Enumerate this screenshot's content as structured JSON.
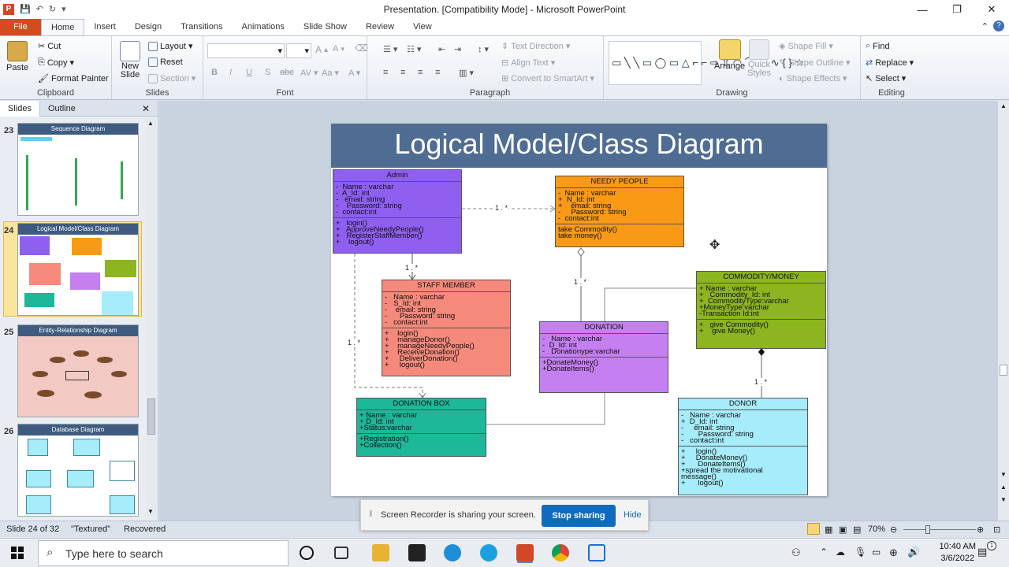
{
  "window": {
    "title": "Presentation. [Compatibility Mode] - Microsoft PowerPoint"
  },
  "tabs": [
    "File",
    "Home",
    "Insert",
    "Design",
    "Transitions",
    "Animations",
    "Slide Show",
    "Review",
    "View"
  ],
  "ribbon": {
    "clipboard": {
      "name": "Clipboard",
      "paste": "Paste",
      "cut": "Cut",
      "copy": "Copy",
      "format_painter": "Format Painter"
    },
    "slides": {
      "name": "Slides",
      "new_slide": "New Slide",
      "layout": "Layout",
      "reset": "Reset",
      "section": "Section"
    },
    "font": {
      "name": "Font"
    },
    "paragraph": {
      "name": "Paragraph",
      "text_direction": "Text Direction",
      "align_text": "Align Text",
      "convert": "Convert to SmartArt"
    },
    "drawing": {
      "name": "Drawing",
      "arrange": "Arrange",
      "quick_styles": "Quick Styles",
      "shape_fill": "Shape Fill",
      "shape_outline": "Shape Outline",
      "shape_effects": "Shape Effects"
    },
    "editing": {
      "name": "Editing",
      "find": "Find",
      "replace": "Replace",
      "select": "Select"
    }
  },
  "pane": {
    "tab_slides": "Slides",
    "tab_outline": "Outline"
  },
  "thumbnails": [
    {
      "num": "23",
      "title": "Sequence Diagram"
    },
    {
      "num": "24",
      "title": "Logical Model/Class Diagram"
    },
    {
      "num": "25",
      "title": "Entity-Relationship Diagram"
    },
    {
      "num": "26",
      "title": "Database Diagram"
    }
  ],
  "slide": {
    "title": "Logical Model/Class Diagram",
    "classes": {
      "admin": {
        "name": "Admin",
        "color": "#8f5ff0",
        "attrs": [
          "-  Name : varchar",
          "-  A_Id: int",
          "-   email: string",
          "-    Password: string",
          "-  contact:int"
        ],
        "ops": [
          "+   login()",
          "+   ApproveNeedyPeople()",
          "+   RegisterStaffMember()",
          "+    logout()"
        ]
      },
      "needy": {
        "name": "NEEDY PEOPLE",
        "color": "#f99a17",
        "attrs": [
          "-  Name : varchar",
          "+  N_Id: int",
          "+    email: string",
          "-     Password: string",
          "-  contact:int"
        ],
        "ops": [
          "take Commodity()",
          "take money()"
        ]
      },
      "staff": {
        "name": "STAFF MEMBER",
        "color": "#f58a7c",
        "attrs": [
          "-   Name : varchar",
          "-   S_Id: int",
          "-    email: string",
          "-      Password: string",
          "-   contact:int"
        ],
        "ops": [
          "+    login()",
          "+    manageDonor()",
          "+    manageNeedyPeople()",
          "+    ReceiveDonation()",
          "+     DeliverDonation()",
          "+     logout()"
        ]
      },
      "donation": {
        "name": "DONATION",
        "color": "#c57ff0",
        "attrs": [
          "-   Name : varchar",
          "-  D_Id: int",
          "-   Donationype:varchar"
        ],
        "ops": [
          "+DonateMoney()",
          "+DonateItems()"
        ]
      },
      "commodity": {
        "name": "COMMODITY/MONEY",
        "color": "#8cb51f",
        "attrs": [
          "+ Name : varchar",
          "+   Commodity_Id: int",
          "+  CommodityType:varchar",
          "+MoneyType:varchar",
          "-Transaction Id:int"
        ],
        "ops": [
          "+   give Commodity()",
          "+    give Money()"
        ]
      },
      "box": {
        "name": "DONATION BOX",
        "color": "#1db79a",
        "attrs": [
          "+ Name : varchar",
          "+ D_Id: int",
          "+Status:varchar"
        ],
        "ops": [
          "+Registration()",
          "+Collection()"
        ]
      },
      "donor": {
        "name": "DONOR",
        "color": "#a6ecfa",
        "attrs": [
          "-   Name : varchar",
          "+  D_Id: int",
          "-     email: string",
          "-       Password: string",
          "-   contact:int"
        ],
        "ops": [
          "+     login()",
          "+     DonateMoney()",
          "+      DonateItems()",
          "+spread the motivational",
          "message()",
          "+      logout()"
        ]
      }
    },
    "multiplicities": [
      "1 . *",
      "1 . *",
      "1 . *",
      "1 . *",
      "1 . *"
    ]
  },
  "status": {
    "slide": "Slide 24 of 32",
    "theme": "\"Textured\"",
    "recovered": "Recovered",
    "zoom": "70%"
  },
  "notification": {
    "message": "Screen Recorder is sharing your screen.",
    "stop": "Stop sharing",
    "hide": "Hide"
  },
  "taskbar": {
    "search_placeholder": "Type here to search",
    "time": "10:40 AM",
    "date": "3/6/2022",
    "notif_count": "1"
  }
}
